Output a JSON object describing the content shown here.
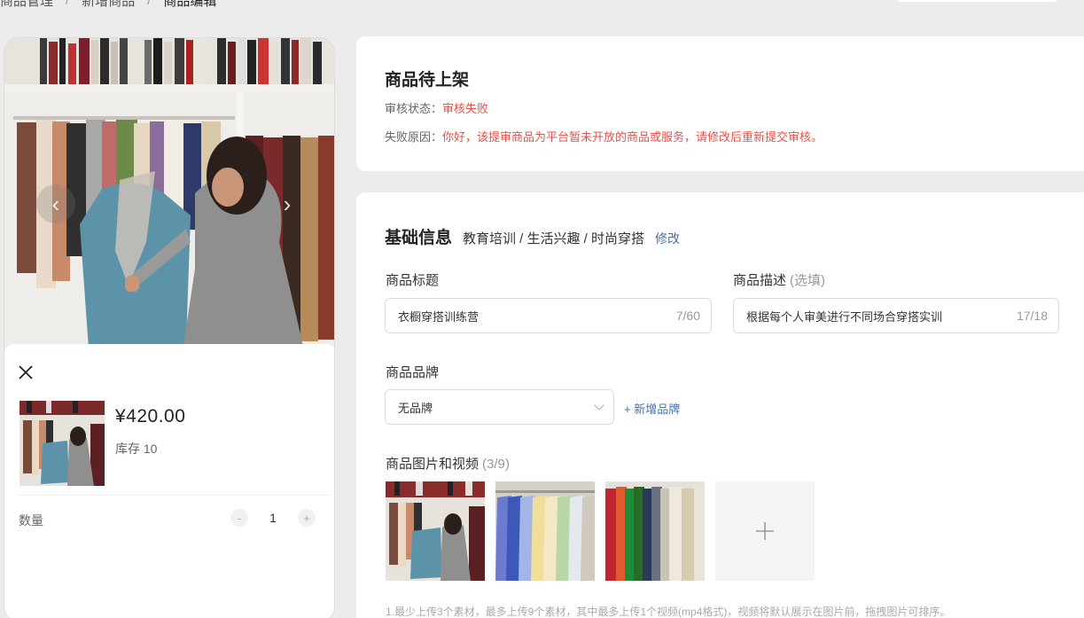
{
  "breadcrumb": {
    "items": [
      "商品管理",
      "新增商品",
      "商品编辑"
    ],
    "separator": "/"
  },
  "preview": {
    "price": "¥420.00",
    "stock": "库存 10",
    "quantity_label": "数量",
    "quantity_value": "1",
    "minus": "-",
    "plus": "+"
  },
  "status": {
    "title": "商品待上架",
    "review_label": "审核状态：",
    "review_value": "审核失败",
    "reason_label": "失败原因：",
    "reason_value": "你好，该提审商品为平台暂未开放的商品或服务，请修改后重新提交审核。"
  },
  "basic": {
    "title": "基础信息",
    "category": "教育培训 / 生活兴趣 / 时尚穿搭",
    "edit_label": "修改",
    "title_label": "商品标题",
    "title_value": "衣橱穿搭训练营",
    "title_count": "7/60",
    "desc_label": "商品描述",
    "desc_optional": "(选填)",
    "desc_value": "根据每个人审美进行不同场合穿搭实训",
    "desc_count": "17/18",
    "brand_label": "商品品牌",
    "brand_value": "无品牌",
    "add_brand": "+ 新增品牌",
    "media_label": "商品图片和视频",
    "media_count": "(3/9)",
    "hint": "1.最少上传3个素材，最多上传9个素材，其中最多上传1个视频(mp4格式)，视频将默认展示在图片前，拖拽图片可排序。"
  },
  "colors": {
    "error": "#e8504a",
    "link": "#4a6fa5",
    "background": "#ececec"
  },
  "icons": {
    "close": "close-icon",
    "prev": "chevron-left-icon",
    "next": "chevron-right-icon",
    "dropdown": "chevron-down-icon",
    "add": "plus-icon"
  }
}
